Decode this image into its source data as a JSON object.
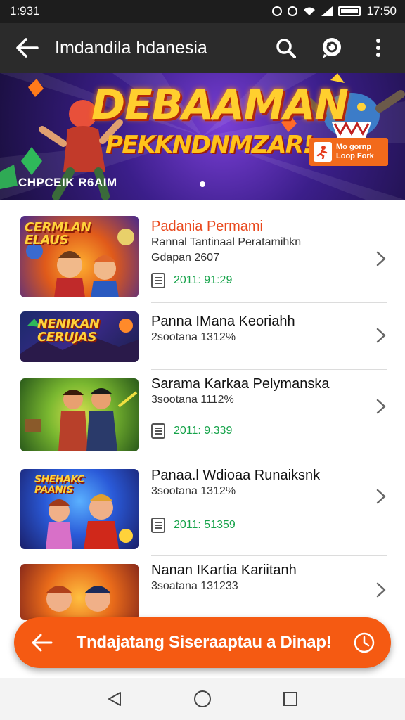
{
  "status_bar": {
    "time_left": "1:931",
    "time_right": "17:50"
  },
  "app_bar": {
    "title": "Imdandila hdanesia",
    "back_icon": "arrow-left-icon",
    "search_icon": "search-icon",
    "chat_icon": "chat-icon",
    "menu_icon": "more-vert-icon"
  },
  "banner": {
    "title": "DEBAAMAN",
    "subtitle": "PEKKNDNMZAR!",
    "caption": "CHPCEIK R6AIM",
    "cta": "Mo gornp\nLoop Fork"
  },
  "items": [
    {
      "thumb_label": "CERMLAN\nELAUS",
      "title": "Padania Permami",
      "subtitle": "Rannal Tantinaal Peratamihkn",
      "subtitle2": "Gdapan 2607",
      "meta": "2011: 91:29",
      "highlight": true
    },
    {
      "thumb_label": "NENIKAN\nCERUJAS",
      "title": "Panna IMana Keoriahh",
      "subtitle": "2sootana 1312%",
      "meta": ""
    },
    {
      "thumb_label": "",
      "title": "Sarama Karkaa Pelymanska",
      "subtitle": "3sootana 1112%",
      "meta": "2011: 9.339"
    },
    {
      "thumb_label": "SHEHAKC\nPAANIS",
      "title": "Panaa.l Wdioaa Runaiksnk",
      "subtitle": "3sootana 1312%",
      "meta": "2011: 51359"
    },
    {
      "thumb_label": "",
      "title": "Nanan IKartia Kariitanh",
      "subtitle": "3soatana 131233",
      "meta": ""
    }
  ],
  "fab": {
    "label": "Tndajatang Siseraaptau a Dinap!",
    "back_icon": "arrow-left-icon",
    "clock_icon": "clock-icon"
  },
  "colors": {
    "accent": "#f55a12",
    "highlight_title": "#e9481c",
    "meta_green": "#16a34a",
    "appbar": "#2b2b2b"
  }
}
